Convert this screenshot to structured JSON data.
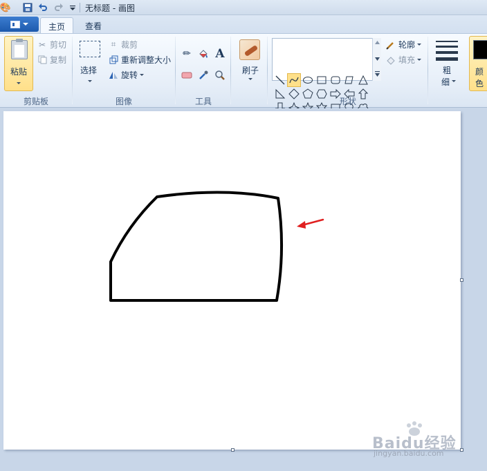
{
  "window": {
    "title": "无标题 - 画图"
  },
  "tabs": [
    {
      "label": "主页",
      "active": true
    },
    {
      "label": "查看",
      "active": false
    }
  ],
  "ribbon": {
    "clipboard": {
      "paste": "粘贴",
      "cut": "剪切",
      "copy": "复制",
      "label": "剪贴板"
    },
    "image": {
      "select": "选择",
      "crop": "裁剪",
      "resize": "重新调整大小",
      "rotate": "旋转",
      "label": "图像"
    },
    "tools": {
      "brush": "刷子",
      "label": "工具"
    },
    "shapes": {
      "outline": "轮廓",
      "fill": "填充",
      "label": "形状"
    },
    "size": {
      "line1": "粗",
      "line2": "细"
    },
    "color": {
      "line1": "颜",
      "line2": "色",
      "value": "#000000"
    }
  },
  "watermark": {
    "brand": "Baidu经验",
    "site": "jingyan.baidu.com"
  },
  "colors": {
    "accent": "#1d5aad",
    "arrow": "#e02020",
    "stroke": "#000000"
  }
}
